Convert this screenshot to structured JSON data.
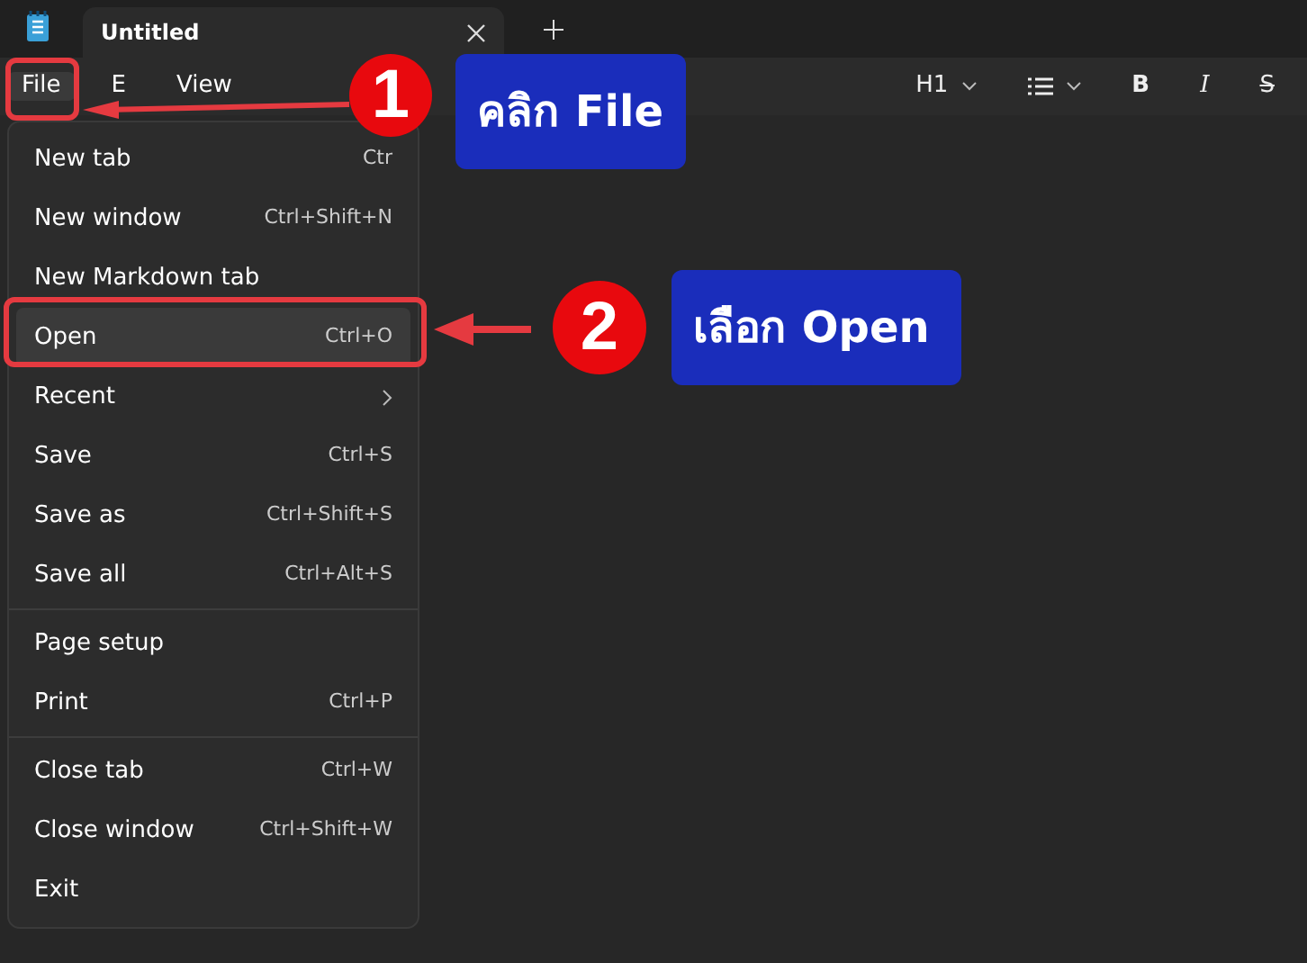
{
  "tabs": [
    {
      "title": "Untitled",
      "selected": true
    }
  ],
  "menubar": [
    {
      "label": "File",
      "selected": true
    },
    {
      "label": "E",
      "selected": false
    },
    {
      "label": "View",
      "selected": false
    }
  ],
  "toolbar": [
    {
      "kind": "heading",
      "label": "H1"
    },
    {
      "kind": "list"
    },
    {
      "kind": "bold",
      "label": "B"
    },
    {
      "kind": "italic",
      "label": "I"
    },
    {
      "kind": "strike",
      "label": "S"
    }
  ],
  "file_menu": [
    {
      "label": "New tab",
      "shortcut": "Ctr",
      "selected": false,
      "kind": "item"
    },
    {
      "label": "New window",
      "shortcut": "Ctrl+Shift+N",
      "selected": false,
      "kind": "item"
    },
    {
      "label": "New Markdown tab",
      "selected": false,
      "kind": "item"
    },
    {
      "label": "Open",
      "shortcut": "Ctrl+O",
      "selected": true,
      "kind": "item"
    },
    {
      "label": "Recent",
      "selected": false,
      "kind": "submenu"
    },
    {
      "label": "Save",
      "shortcut": "Ctrl+S",
      "selected": false,
      "kind": "item"
    },
    {
      "label": "Save as",
      "shortcut": "Ctrl+Shift+S",
      "selected": false,
      "kind": "item"
    },
    {
      "label": "Save all",
      "shortcut": "Ctrl+Alt+S",
      "selected": false,
      "kind": "item"
    },
    {
      "kind": "separator"
    },
    {
      "label": "Page setup",
      "selected": false,
      "kind": "item"
    },
    {
      "label": "Print",
      "shortcut": "Ctrl+P",
      "selected": false,
      "kind": "item"
    },
    {
      "kind": "separator"
    },
    {
      "label": "Close tab",
      "shortcut": "Ctrl+W",
      "selected": false,
      "kind": "item"
    },
    {
      "label": "Close window",
      "shortcut": "Ctrl+Shift+W",
      "selected": false,
      "kind": "item"
    },
    {
      "label": "Exit",
      "selected": false,
      "kind": "item"
    }
  ],
  "annotations": [
    {
      "number": "1",
      "label": "คลิก File"
    },
    {
      "number": "2",
      "label": "เลือก Open"
    }
  ]
}
